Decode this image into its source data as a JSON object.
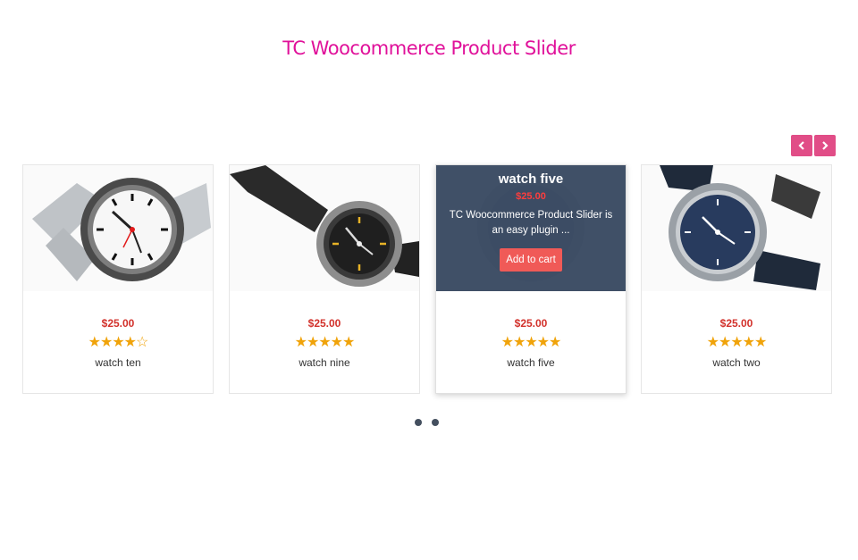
{
  "header": {
    "title": "TC Woocommerce Product Slider"
  },
  "nav": {
    "prev_icon": "chevron-left-icon",
    "next_icon": "chevron-right-icon",
    "accent": "#e14d87"
  },
  "products": [
    {
      "name": "watch ten",
      "price": "$25.00",
      "rating": 4,
      "stars": "★★★★",
      "empty_stars": "☆"
    },
    {
      "name": "watch nine",
      "price": "$25.00",
      "rating": 5,
      "stars": "★★★★★",
      "empty_stars": ""
    },
    {
      "name": "watch five",
      "price": "$25.00",
      "rating": 5,
      "stars": "★★★★★",
      "empty_stars": ""
    },
    {
      "name": "watch two",
      "price": "$25.00",
      "rating": 5,
      "stars": "★★★★★",
      "empty_stars": ""
    }
  ],
  "hover_overlay": {
    "name": "watch five",
    "price": "$25.00",
    "description": "TC Woocommerce Product Slider is an easy plugin ...",
    "add_to_cart": "Add to cart"
  },
  "pagination": {
    "pages": 2,
    "current": 1
  },
  "colors": {
    "title": "#e0119a",
    "price": "#d2312b",
    "star": "#f0a30a",
    "overlay": "#3a4a62",
    "cart_button": "#f05a57"
  }
}
